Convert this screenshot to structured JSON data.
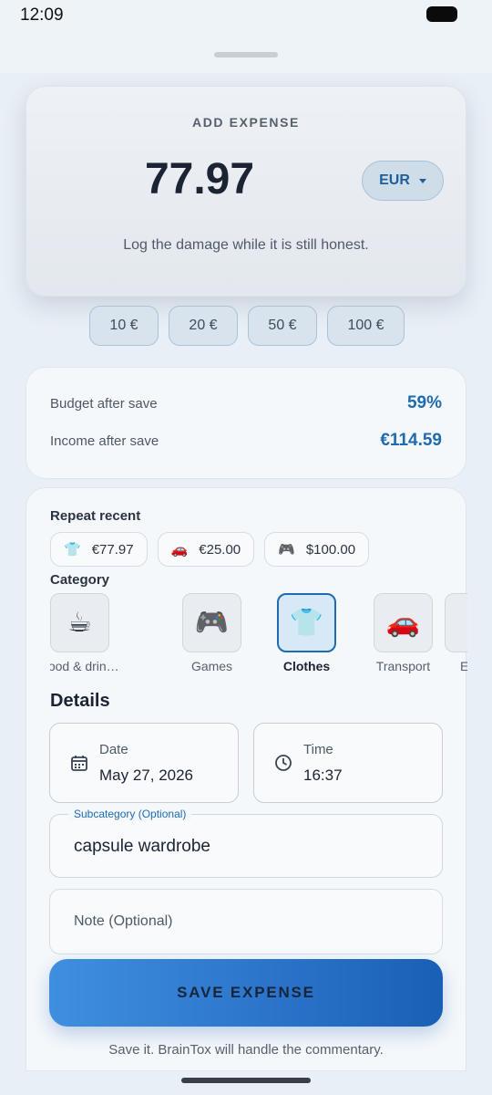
{
  "status": {
    "time": "12:09"
  },
  "hero": {
    "title": "ADD EXPENSE",
    "amount": "77.97",
    "currency": "EUR",
    "subtitle": "Log the damage while it is still honest."
  },
  "quick_amounts": [
    "10 €",
    "20 €",
    "50 €",
    "100 €"
  ],
  "stats": {
    "budget_label": "Budget after save",
    "budget_value": "59%",
    "income_label": "Income after save",
    "income_value": "€114.59"
  },
  "repeat_recent": {
    "label": "Repeat recent",
    "items": [
      {
        "icon": "👕",
        "amount": "€77.97"
      },
      {
        "icon": "🚗",
        "amount": "€25.00"
      },
      {
        "icon": "🎮",
        "amount": "$100.00"
      }
    ]
  },
  "category": {
    "label": "Category",
    "items": [
      {
        "icon": "☕",
        "label": "Food & drin…"
      },
      {
        "icon": "🎮",
        "label": "Games"
      },
      {
        "icon": "👕",
        "label": "Clothes",
        "selected": true
      },
      {
        "icon": "🚗",
        "label": "Transport"
      },
      {
        "icon": "",
        "label": "Er"
      }
    ]
  },
  "details": {
    "title": "Details",
    "date_label": "Date",
    "date_value": "May 27, 2026",
    "time_label": "Time",
    "time_value": "16:37",
    "subcategory_label": "Subcategory (Optional)",
    "subcategory_value": "capsule wardrobe",
    "note_placeholder": "Note (Optional)"
  },
  "save": {
    "label": "SAVE EXPENSE",
    "hint": "Save it. BrainTox will handle the commentary."
  },
  "colors": {
    "accent": "#1f6bb0",
    "button": "#2a72c9"
  }
}
